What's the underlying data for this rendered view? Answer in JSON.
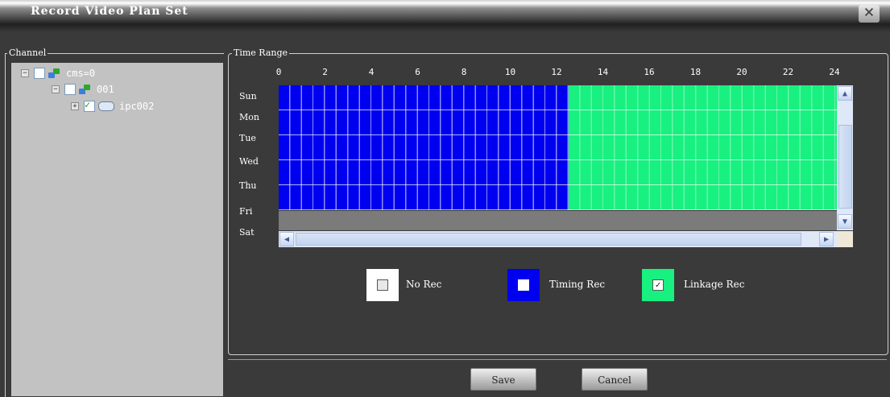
{
  "window": {
    "title": "Record Video Plan Set",
    "close_label": "×"
  },
  "channel": {
    "legend": "Channel",
    "tree": [
      {
        "expander": "−",
        "checked": false,
        "icon": "network-icon",
        "label": "cms=0"
      },
      {
        "expander": "−",
        "checked": false,
        "icon": "network-icon",
        "label": "001"
      },
      {
        "expander": "+",
        "checked": true,
        "icon": "camera-icon",
        "label": "ipc002"
      }
    ]
  },
  "time_range": {
    "legend": "Time Range",
    "hours": [
      "0",
      "2",
      "4",
      "6",
      "8",
      "10",
      "12",
      "14",
      "16",
      "18",
      "20",
      "22",
      "24"
    ],
    "days": [
      "Sun",
      "Mon",
      "Tue",
      "Wed",
      "Thu",
      "Fri",
      "Sat"
    ],
    "schedule_colors": {
      "timing": "#0000f0",
      "linkage": "#18f080",
      "none": "#7b7b7b"
    },
    "timing_until_hour": 12.5
  },
  "legend": {
    "no_rec": "No Rec",
    "timing_rec": "Timing Rec",
    "linkage_rec": "Linkage Rec"
  },
  "buttons": {
    "save": "Save",
    "cancel": "Cancel"
  }
}
